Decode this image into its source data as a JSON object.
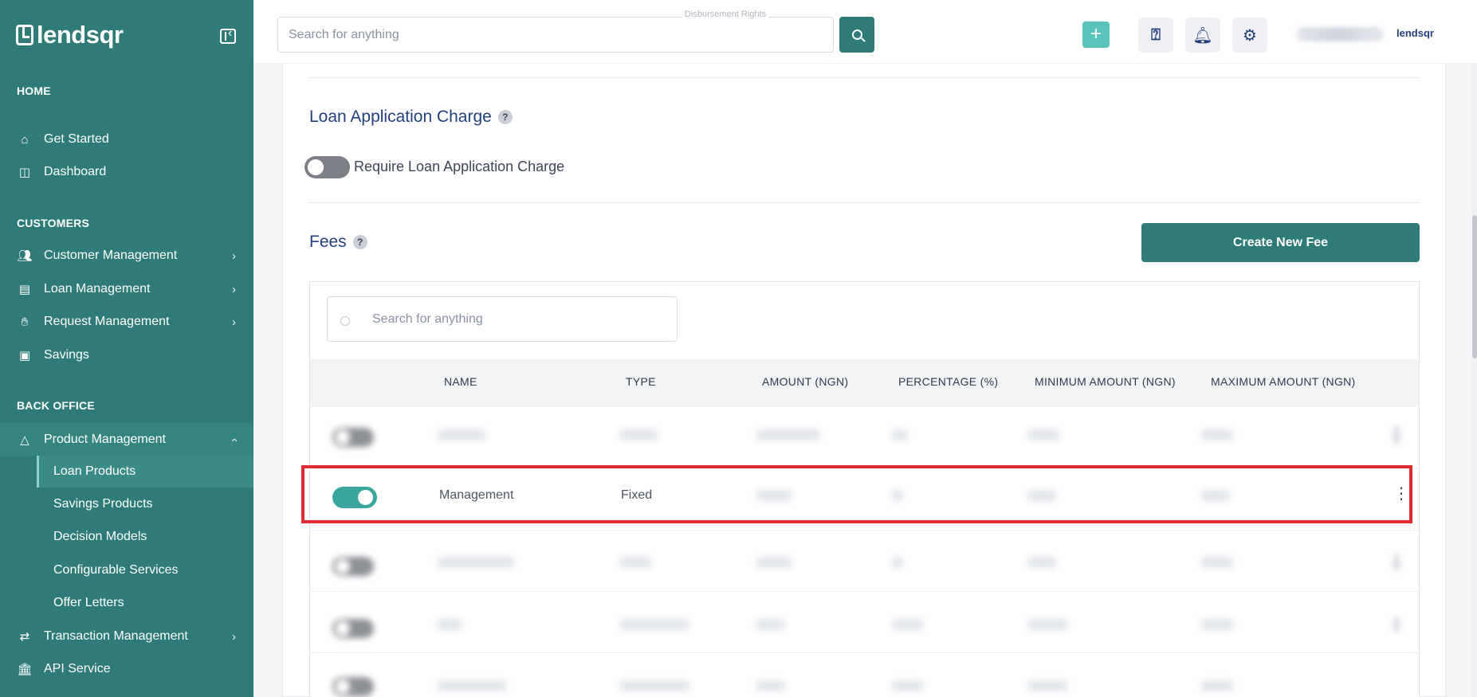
{
  "brand": {
    "name": "lendsqr"
  },
  "sidebar": {
    "sections": {
      "home": "HOME",
      "customers": "CUSTOMERS",
      "back_office": "BACK OFFICE"
    },
    "items": {
      "get_started": "Get Started",
      "dashboard": "Dashboard",
      "customer_management": "Customer Management",
      "loan_management": "Loan Management",
      "request_management": "Request Management",
      "savings": "Savings",
      "product_management": "Product Management",
      "transaction_management": "Transaction Management",
      "api_service": "API Service"
    },
    "sub_items": {
      "loan_products": "Loan Products",
      "savings_products": "Savings Products",
      "decision_models": "Decision Models",
      "configurable_services": "Configurable Services",
      "offer_letters": "Offer Letters"
    }
  },
  "header": {
    "search_placeholder": "Search for anything",
    "search_caption": "Disbursement Rights",
    "plus": "+",
    "help_icon": "help-book-icon",
    "bell_icon": "bell-icon",
    "gear_icon": "gear-icon",
    "logo_small": "lendsqr"
  },
  "main": {
    "loan_application_charge": {
      "heading": "Loan Application Charge",
      "help": "?",
      "toggle_label": "Require Loan Application Charge",
      "enabled": false
    },
    "fees": {
      "heading": "Fees",
      "help": "?",
      "create_button": "Create New Fee",
      "search_placeholder": "Search for anything",
      "columns": [
        "NAME",
        "TYPE",
        "AMOUNT (NGN)",
        "PERCENTAGE (%)",
        "MINIMUM AMOUNT (NGN)",
        "MAXIMUM AMOUNT (NGN)"
      ],
      "highlighted_row": {
        "name": "Management",
        "type": "Fixed",
        "enabled": true
      }
    }
  },
  "colors": {
    "primary": "#2e7b77",
    "accent": "#58c4bc",
    "highlight_border": "#e02a35",
    "text_navy": "#213f7d"
  }
}
